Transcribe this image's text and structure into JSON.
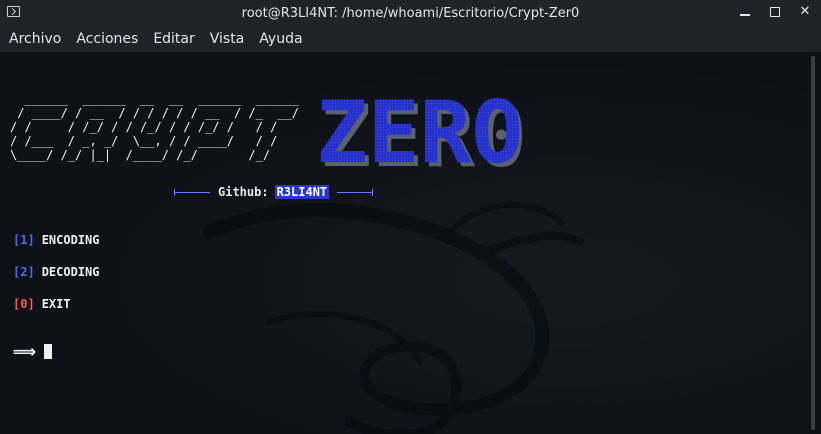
{
  "window": {
    "title": "root@R3LI4NT: /home/whoami/Escritorio/Crypt-Zer0",
    "controls": {
      "minimize": "minimize-icon",
      "maximize": "maximize-icon",
      "close": "✕"
    }
  },
  "menubar": {
    "items": [
      "Archivo",
      "Acciones",
      "Editar",
      "Vista",
      "Ayuda"
    ]
  },
  "terminal": {
    "banner": {
      "ascii_left": "  ______  ______  __  __  ______  ______\n / ____/ / __  / / / / / / __  / /_  __/\n/ /     / /_/ / / /_/ / / /_/ /   / /   \n/ /___  / _, _/  \\__, / / ____/   / /    \n\\____/ /_/ |_|  /____/ /_/       /_/     ",
      "ascii_right_text": "ZERO",
      "colors": {
        "zero_fill": "#2531c8",
        "zero_shadow": "#7a7f8f"
      }
    },
    "github": {
      "label": "Github:",
      "user": "R3LI4NT"
    },
    "options": [
      {
        "key": "[1]",
        "label": "ENCODING",
        "color": "#5566ff"
      },
      {
        "key": "[2]",
        "label": "DECODING",
        "color": "#5566ff"
      },
      {
        "key": "[0]",
        "label": "EXIT",
        "color": "#ff5a4f"
      }
    ],
    "prompt_symbol": "⟹"
  }
}
